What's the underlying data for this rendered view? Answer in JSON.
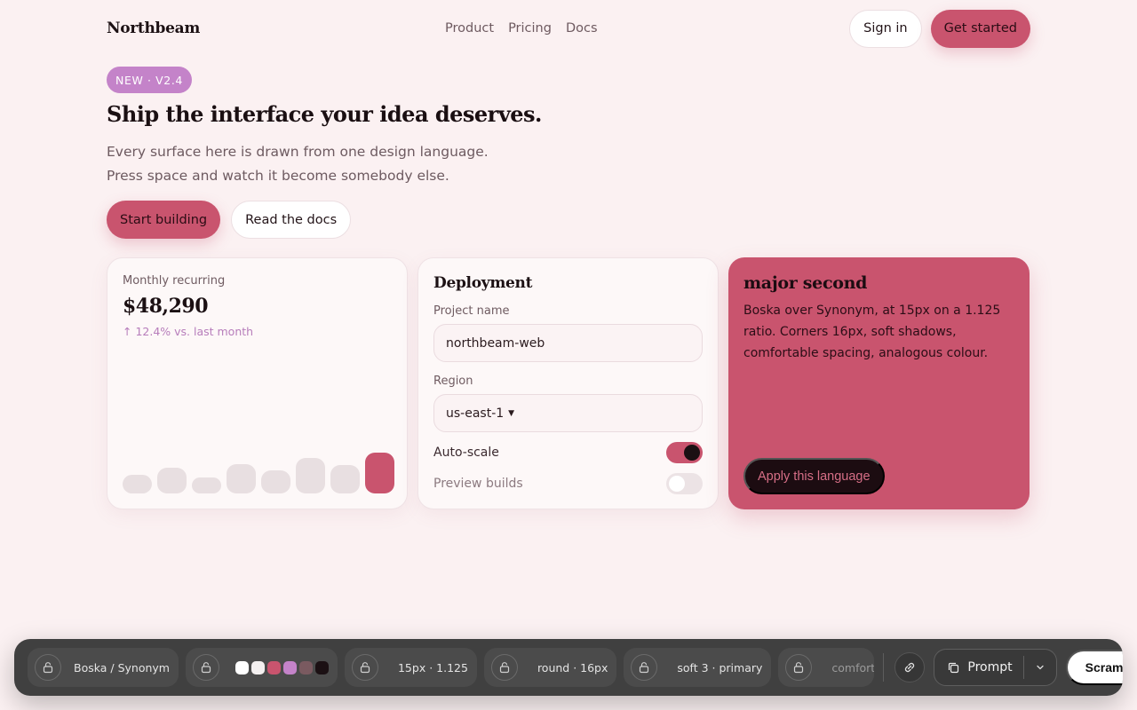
{
  "header": {
    "logo": "Northbeam",
    "nav": [
      "Product",
      "Pricing",
      "Docs"
    ],
    "sign_in": "Sign in",
    "get_started": "Get started"
  },
  "hero": {
    "badge": "NEW · V2.4",
    "title": "Ship the interface your idea deserves.",
    "subtitle_line1": "Every surface here is drawn from one design language.",
    "subtitle_line2": "Press space and watch it become somebody else.",
    "primary_cta": "Start building",
    "secondary_cta": "Read the docs"
  },
  "metric_card": {
    "label": "Monthly recurring",
    "value": "$48,290",
    "delta": "↑ 12.4% vs. last month",
    "bars": [
      0.33,
      0.45,
      0.28,
      0.52,
      0.41,
      0.62,
      0.5,
      0.72
    ],
    "highlight_index": 7
  },
  "deployment_card": {
    "title": "Deployment",
    "project_label": "Project name",
    "project_value": "northbeam-web",
    "region_label": "Region",
    "region_value": "us-east-1",
    "autoscale_label": "Auto-scale",
    "autoscale_on": true,
    "preview_label": "Preview builds",
    "preview_on": false
  },
  "language_card": {
    "title": "major second",
    "description": "Boska over Synonym, at 15px on a 1.125 ratio. Corners 16px, soft shadows, comfortable spacing, analogous colour.",
    "apply": "Apply this language"
  },
  "toolbar": {
    "fonts": "Boska / Synonym",
    "swatches": [
      "#ffffff",
      "#f4f0f0",
      "#c9546e",
      "#c483c9",
      "#7a5a60",
      "#1b1013"
    ],
    "scale": "15px · 1.125",
    "corners": "round · 16px",
    "shadow": "soft 3 · primary",
    "spacing": "comfortable",
    "prompt": "Prompt",
    "scramble": "Scramble"
  },
  "colors": {
    "background": "#fbf1f2",
    "primary": "#c9546e",
    "accent": "#c483c9",
    "toolbar": "#404040"
  }
}
